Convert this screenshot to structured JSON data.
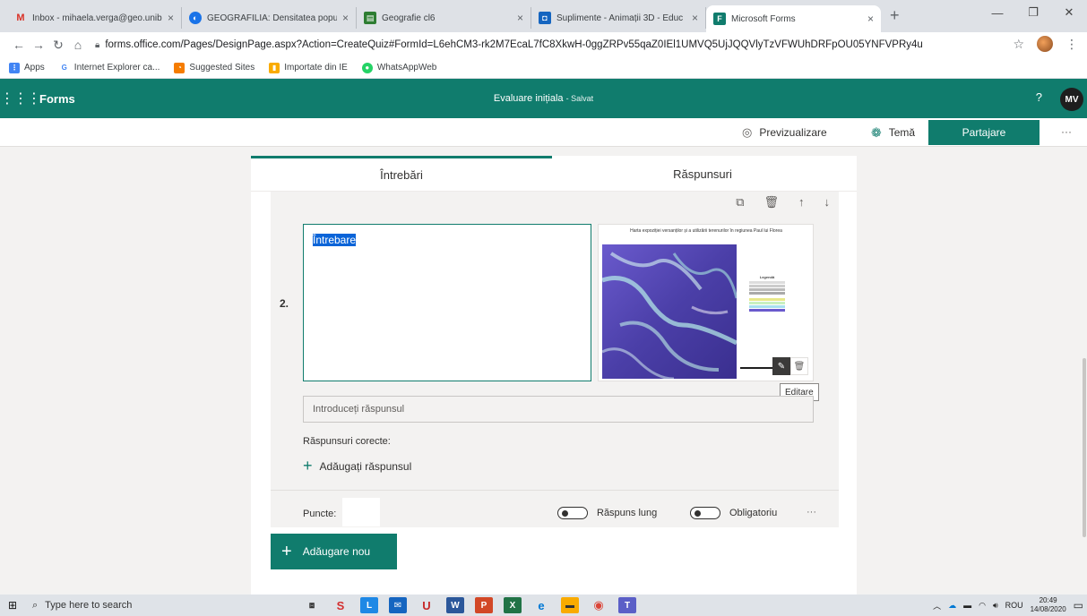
{
  "browser": {
    "tabs": [
      {
        "title": "Inbox - mihaela.verga@geo.unib",
        "icon": "gmail-icon",
        "color": "#d93025",
        "glyph": "M"
      },
      {
        "title": "GEOGRAFILIA: Densitatea popula",
        "icon": "blog-icon",
        "color": "#1a73e8",
        "glyph": "◐"
      },
      {
        "title": "Geografie cl6",
        "icon": "slides-icon",
        "color": "#2e7d32",
        "glyph": "▤"
      },
      {
        "title": "Suplimente - Animații 3D - Educ",
        "icon": "edu-icon",
        "color": "#1565c0",
        "glyph": "◘"
      },
      {
        "title": "Microsoft Forms",
        "icon": "forms-icon",
        "color": "#107c6d",
        "glyph": "F"
      }
    ],
    "url": "forms.office.com/Pages/DesignPage.aspx?Action=CreateQuiz#FormId=L6ehCM3-rk2M7EcaL7fC8XkwH-0ggZRPv55qaZ0IEl1UMVQ5UjJQQVlyTzVFWUhDRFpOU05YNFVPRy4u",
    "bookmarks": [
      {
        "label": "Apps",
        "color": "#4285f4",
        "glyph": "⋮"
      },
      {
        "label": "Internet Explorer ca...",
        "color": "#4285f4",
        "glyph": "G"
      },
      {
        "label": "Suggested Sites",
        "color": "#f57c00",
        "glyph": "◔"
      },
      {
        "label": "Importate din IE",
        "color": "#f9ab00",
        "glyph": "▮"
      },
      {
        "label": "WhatsAppWeb",
        "color": "#25d366",
        "glyph": "●"
      }
    ]
  },
  "forms": {
    "app_name": "Forms",
    "form_title": "Evaluare inițiala",
    "saved_status": "- Salvat",
    "help": "?",
    "user_initials": "MV",
    "toolbar": {
      "preview": "Previzualizare",
      "theme": "Temă",
      "share": "Partajare",
      "more": "···"
    },
    "tabs": {
      "questions": "Întrebări",
      "responses": "Răspunsuri"
    },
    "question": {
      "number": "2.",
      "text": "Întrebare",
      "image_title": "Harta expoziției versanților și a utilizării terenurilor în regiunea Paul lui Florea",
      "image_legend_title": "Legendă",
      "edit_tooltip": "Editare",
      "answer_placeholder": "Introduceți răspunsul",
      "correct_answers_label": "Răspunsuri corecte:",
      "add_answer": "Adăugați răspunsul",
      "points_label": "Puncte:",
      "long_answer_label": "Răspuns lung",
      "required_label": "Obligatoriu",
      "more": "···"
    },
    "add_new": "Adăugare nou",
    "accent_color": "#107c6d"
  },
  "taskbar": {
    "search_placeholder": "Type here to search",
    "language": "ROU",
    "time": "20:49",
    "date": "14/08/2020"
  }
}
